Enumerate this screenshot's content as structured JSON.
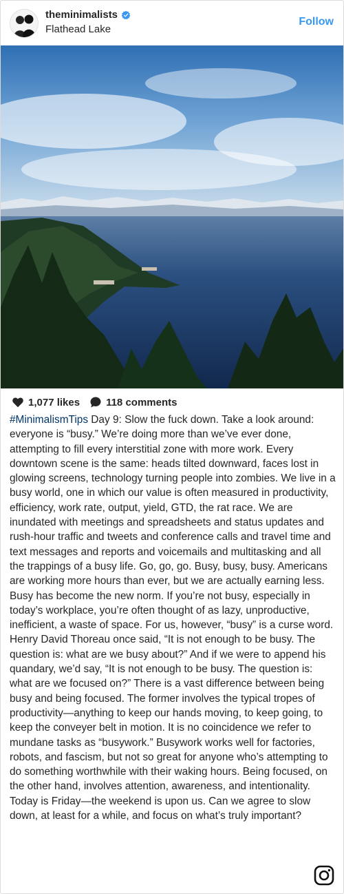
{
  "header": {
    "username": "theminimalists",
    "location": "Flathead Lake",
    "follow_label": "Follow"
  },
  "post": {
    "likes": "1,077 likes",
    "comments": "118 comments",
    "caption_hashtag": "#MinimalismTips",
    "caption_text": " Day 9: Slow the fuck down. Take a look around: everyone is “busy.” We’re doing more than we’ve ever done, attempting to fill every interstitial zone with more work. Every downtown scene is the same: heads tilted downward, faces lost in glowing screens, technology turning people into zombies. We live in a busy world, one in which our value is often measured in productivity, efficiency, work rate, output, yield, GTD, the rat race. We are inundated with meetings and spreadsheets and status updates and rush-hour traffic and tweets and conference calls and travel time and text messages and reports and voicemails and multitasking and all the trappings of a busy life. Go, go, go. Busy, busy, busy. Americans are working more hours than ever, but we are actually earning less. Busy has become the new norm. If you’re not busy, especially in today’s workplace, you’re often thought of as lazy, unproductive, inefficient, a waste of space. For us, however, “busy” is a curse word. Henry David Thoreau once said, “It is not enough to be busy. The question is: what are we busy about?” And if we were to append his quandary, we’d say, “It is not enough to be busy. The question is: what are we focused on?” There is a vast difference between being busy and being focused. The former involves the typical tropes of productivity—anything to keep our hands moving, to keep going, to keep the conveyer belt in motion. It is no coincidence we refer to mundane tasks as “busywork.” Busywork works well for factories, robots, and fascism, but not so great for anyone who’s attempting to do something worthwhile with their waking hours. Being focused, on the other hand, involves attention, awareness, and intentionality. Today is Friday—the weekend is upon us. Can we agree to slow down, at least for a while, and focus on what’s truly important?"
  },
  "icons": {
    "verified": "verified-badge-icon",
    "likes": "heart-icon",
    "comments": "comment-bubble-icon",
    "brand": "instagram-icon"
  },
  "colors": {
    "follow": "#3897f0",
    "hashtag": "#003569",
    "verified": "#3897f0"
  }
}
